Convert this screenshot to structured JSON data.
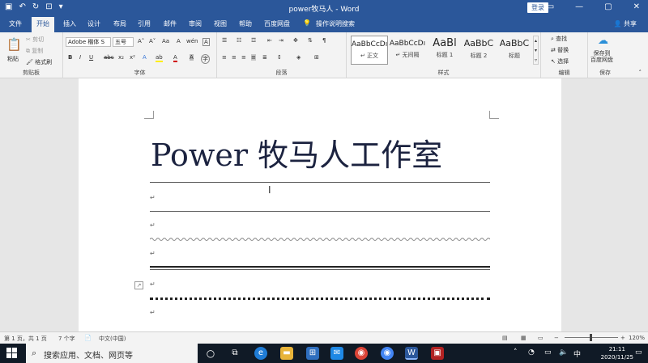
{
  "window": {
    "title": "power牧马人 - Word",
    "login_label": "登录",
    "share_label": "共享",
    "qat": {
      "save": "▣",
      "undo": "↶",
      "redo": "↻",
      "custom": "⊡",
      "more": "▾"
    },
    "controls": {
      "ribbon_options": "▭",
      "minimize": "—",
      "maximize": "▢",
      "close": "✕"
    }
  },
  "tabs": [
    "文件",
    "开始",
    "插入",
    "设计",
    "布局",
    "引用",
    "邮件",
    "审阅",
    "视图",
    "帮助",
    "百度网盘",
    "操作说明搜索"
  ],
  "ribbon": {
    "clipboard": {
      "paste": "粘贴",
      "cut": "剪切",
      "copy": "复制",
      "format_painter": "格式刷",
      "label": "剪贴板"
    },
    "font": {
      "name": "Adobe 楷体 S",
      "size": "五号",
      "label": "字体",
      "grow": "A˄",
      "shrink": "A˅",
      "case": "Aa",
      "clear": "A",
      "phonetic": "wén",
      "border": "A",
      "bold": "B",
      "italic": "I",
      "underline": "U",
      "strike": "abc",
      "sub": "x₂",
      "sup": "x²",
      "effects": "A",
      "highlight": "ab",
      "color": "A",
      "shade": "A",
      "circle": "字"
    },
    "paragraph": {
      "label": "段落"
    },
    "styles": {
      "label": "样式",
      "items": [
        {
          "sample": "AaBbCcDı",
          "name": "↵ 正文"
        },
        {
          "sample": "AaBbCcDı",
          "name": "↵ 无间隔"
        },
        {
          "sample": "AaBl",
          "name": "标题 1"
        },
        {
          "sample": "AaBbC",
          "name": "标题 2"
        },
        {
          "sample": "AaBbC",
          "name": "标题"
        }
      ]
    },
    "editing": {
      "find": "查找",
      "replace": "替换",
      "select": "选择",
      "label": "编辑"
    },
    "save_group": {
      "save_baidu": "保存到\n百度网盘",
      "label": "保存"
    }
  },
  "document": {
    "title": "Power 牧马人工作室",
    "para_mark": "↵"
  },
  "status": {
    "page": "第 1 页，共 1 页",
    "words": "7 个字",
    "language": "中文(中国)",
    "zoom": "120%"
  },
  "taskbar": {
    "search_placeholder": "搜索应用、文档、网页等",
    "ime": "中",
    "time": "21:11",
    "date": "2020/11/25"
  }
}
